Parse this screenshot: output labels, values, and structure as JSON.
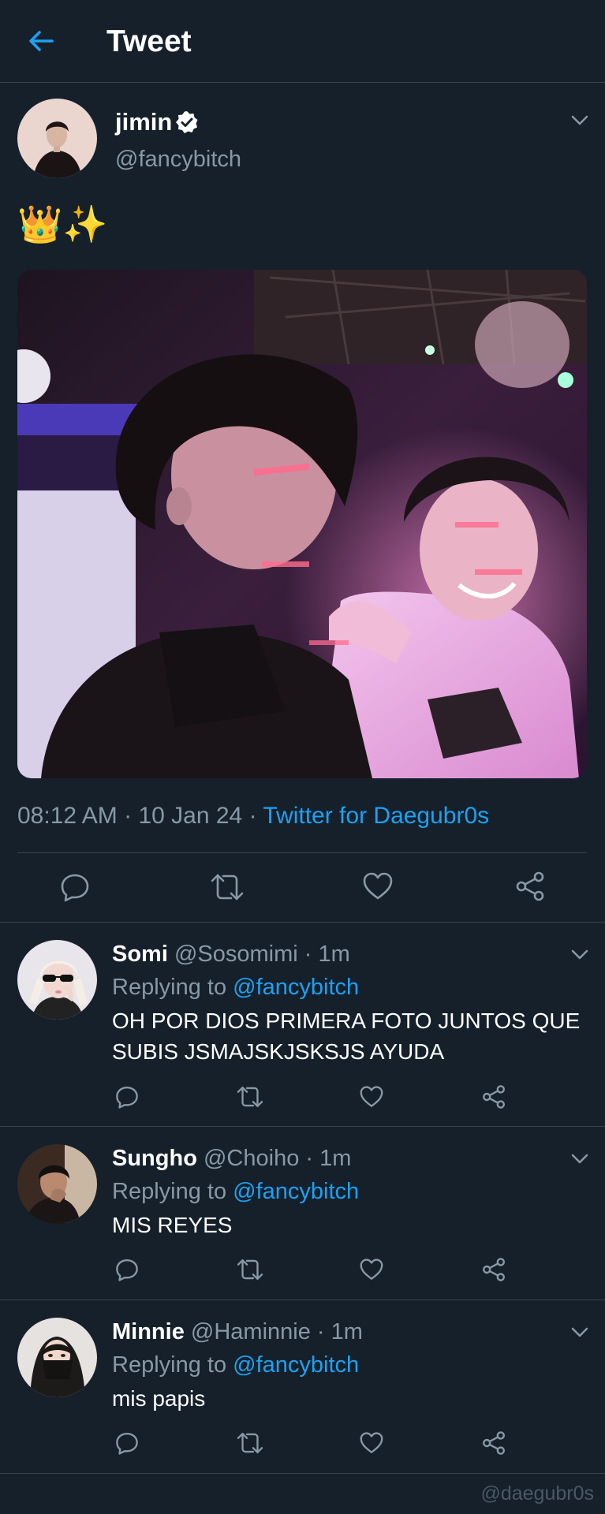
{
  "header": {
    "title": "Tweet"
  },
  "tweet": {
    "name": "jimin",
    "handle": "@fancybitch",
    "text": "👑✨",
    "time": "08:12 AM",
    "date": "10 Jan 24",
    "source": "Twitter for Daegubr0s"
  },
  "replies": [
    {
      "name": "Somi",
      "handle": "@Sosomimi",
      "time": "1m",
      "replying_prefix": "Replying to ",
      "replying_to": "@fancybitch",
      "text": "OH POR DIOS PRIMERA FOTO JUNTOS QUE SUBIS JSMAJSKJSKSJS AYUDA"
    },
    {
      "name": "Sungho",
      "handle": "@Choiho",
      "time": "1m",
      "replying_prefix": "Replying to ",
      "replying_to": "@fancybitch",
      "text": "MIS REYES"
    },
    {
      "name": "Minnie",
      "handle": "@Haminnie",
      "time": "1m",
      "replying_prefix": "Replying to ",
      "replying_to": "@fancybitch",
      "text": "mis papis"
    }
  ],
  "separators": {
    "dot": "·"
  },
  "watermark": "@daegubr0s",
  "colors": {
    "background": "#15202b",
    "accent": "#1da1f2",
    "secondary_text": "#8899a6",
    "divider": "#38444d"
  },
  "icons": [
    "back-arrow-icon",
    "verified-badge-icon",
    "chevron-down-icon",
    "reply-icon",
    "retweet-icon",
    "like-icon",
    "share-icon"
  ]
}
